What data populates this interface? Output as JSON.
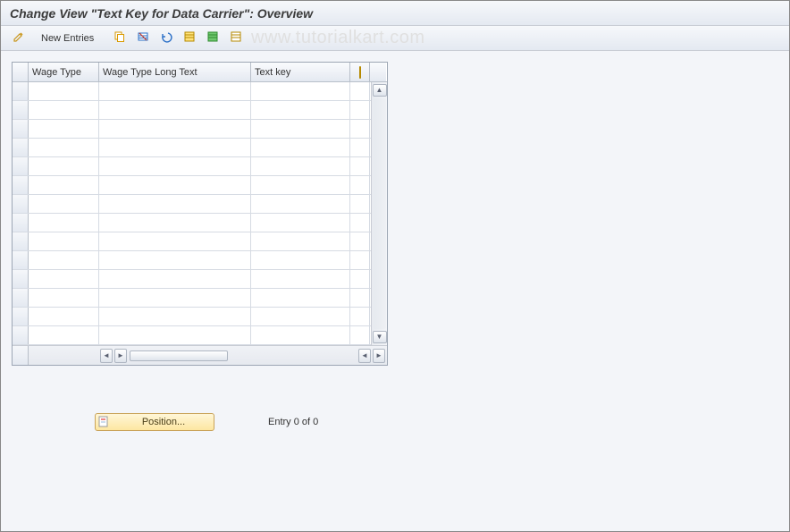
{
  "header": {
    "title": "Change View \"Text Key for Data Carrier\": Overview"
  },
  "toolbar": {
    "icons": {
      "pen": "pen-icon",
      "copy": "copy-icon",
      "delete": "delete-row-icon",
      "undo": "undo-icon",
      "select_all": "select-all-icon",
      "select_block": "select-block-icon",
      "deselect_all": "deselect-all-icon"
    },
    "new_entries_label": "New Entries"
  },
  "watermark": "www.tutorialkart.com",
  "table": {
    "columns": [
      "Wage Type",
      "Wage Type Long Text",
      "Text key"
    ],
    "settings_icon": "table-settings-icon",
    "row_count": 14,
    "rows": [
      {
        "wage_type": "",
        "long_text": "",
        "text_key": ""
      },
      {
        "wage_type": "",
        "long_text": "",
        "text_key": ""
      },
      {
        "wage_type": "",
        "long_text": "",
        "text_key": ""
      },
      {
        "wage_type": "",
        "long_text": "",
        "text_key": ""
      },
      {
        "wage_type": "",
        "long_text": "",
        "text_key": ""
      },
      {
        "wage_type": "",
        "long_text": "",
        "text_key": ""
      },
      {
        "wage_type": "",
        "long_text": "",
        "text_key": ""
      },
      {
        "wage_type": "",
        "long_text": "",
        "text_key": ""
      },
      {
        "wage_type": "",
        "long_text": "",
        "text_key": ""
      },
      {
        "wage_type": "",
        "long_text": "",
        "text_key": ""
      },
      {
        "wage_type": "",
        "long_text": "",
        "text_key": ""
      },
      {
        "wage_type": "",
        "long_text": "",
        "text_key": ""
      },
      {
        "wage_type": "",
        "long_text": "",
        "text_key": ""
      },
      {
        "wage_type": "",
        "long_text": "",
        "text_key": ""
      }
    ]
  },
  "footer": {
    "position_label": "Position...",
    "entry_text": "Entry 0 of 0"
  }
}
